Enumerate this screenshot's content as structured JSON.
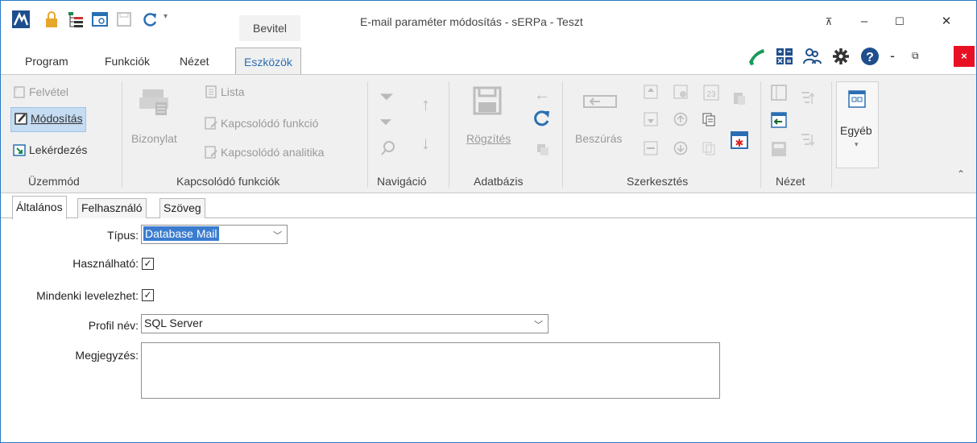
{
  "window": {
    "context_tab": "Bevitel",
    "title": "E-mail paraméter módosítás - sERPa - Teszt"
  },
  "menu": {
    "tabs": [
      "Program",
      "Funkciók",
      "Nézet",
      "Eszközök"
    ]
  },
  "ribbon": {
    "uzemmod": {
      "label": "Üzemmód",
      "felvetel": "Felvétel",
      "modositas": "Módosítás",
      "lekerdezes": "Lekérdezés"
    },
    "kapcsolodo": {
      "label": "Kapcsolódó funkciók",
      "bizonylat": "Bizonylat",
      "lista": "Lista",
      "funkcio": "Kapcsolódó funkció",
      "analitika": "Kapcsolódó analitika"
    },
    "navigacio": {
      "label": "Navigáció"
    },
    "adatbazis": {
      "label": "Adatbázis",
      "rogzites": "Rögzítés"
    },
    "szerkesztes": {
      "label": "Szerkesztés",
      "beszuras": "Beszúrás"
    },
    "nezet": {
      "label": "Nézet"
    },
    "egyeb": {
      "label": "Egyéb"
    }
  },
  "form": {
    "tabs": [
      "Általános",
      "Felhasználó",
      "Szöveg"
    ],
    "tipus_label": "Típus:",
    "tipus_value": "Database Mail",
    "hasznalhato_label": "Használható:",
    "hasznalhato_checked": "✓",
    "mindenki_label": "Mindenki levelezhet:",
    "mindenki_checked": "✓",
    "profil_label": "Profil név:",
    "profil_value": "SQL Server",
    "megjegyzes_label": "Megjegyzés:",
    "megjegyzes_value": ""
  },
  "colors": {
    "accent": "#2a6fb3",
    "selected_button": "#c5dcf2",
    "close_button": "#e81123",
    "phone_icon": "#1a9a5a"
  }
}
